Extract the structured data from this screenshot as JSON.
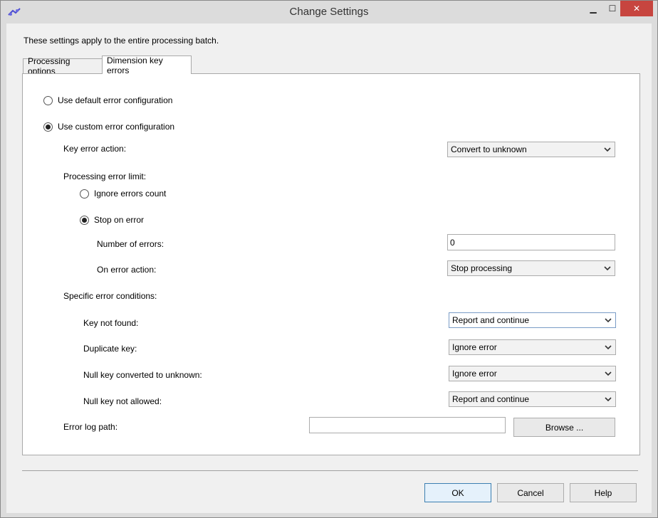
{
  "window": {
    "title": "Change Settings",
    "minimize_symbol": "▁",
    "maximize_symbol": "☐",
    "close_symbol": "✕"
  },
  "intro": "These settings apply to the entire processing batch.",
  "tabs": [
    {
      "label": "Processing options",
      "selected": false
    },
    {
      "label": "Dimension key errors",
      "selected": true
    }
  ],
  "config": {
    "default_label": "Use default error configuration",
    "custom_label": "Use custom error configuration",
    "selected": "custom"
  },
  "key_error_action": {
    "label": "Key error action:",
    "value": "Convert to unknown"
  },
  "processing_error_limit": {
    "label": "Processing error limit:",
    "ignore_label": "Ignore errors count",
    "stop_label": "Stop on error",
    "selected": "stop",
    "number_of_errors_label": "Number of errors:",
    "number_of_errors_value": "0",
    "on_error_action_label": "On error action:",
    "on_error_action_value": "Stop processing"
  },
  "specific_conditions": {
    "label": "Specific error conditions:",
    "key_not_found": {
      "label": "Key not found:",
      "value": "Report and continue"
    },
    "duplicate_key": {
      "label": "Duplicate key:",
      "value": "Ignore error"
    },
    "null_key_converted": {
      "label": "Null key converted to unknown:",
      "value": "Ignore error"
    },
    "null_key_not_allowed": {
      "label": "Null key not allowed:",
      "value": "Report and continue"
    }
  },
  "error_log": {
    "label": "Error log path:",
    "value": "",
    "browse_label": "Browse ..."
  },
  "buttons": {
    "ok": "OK",
    "cancel": "Cancel",
    "help": "Help"
  },
  "icons": {
    "app": "processing-icon",
    "dropdown": "chevron-down-icon"
  },
  "colors": {
    "close_button": "#c7453f",
    "default_button_border": "#3c7fb1"
  }
}
